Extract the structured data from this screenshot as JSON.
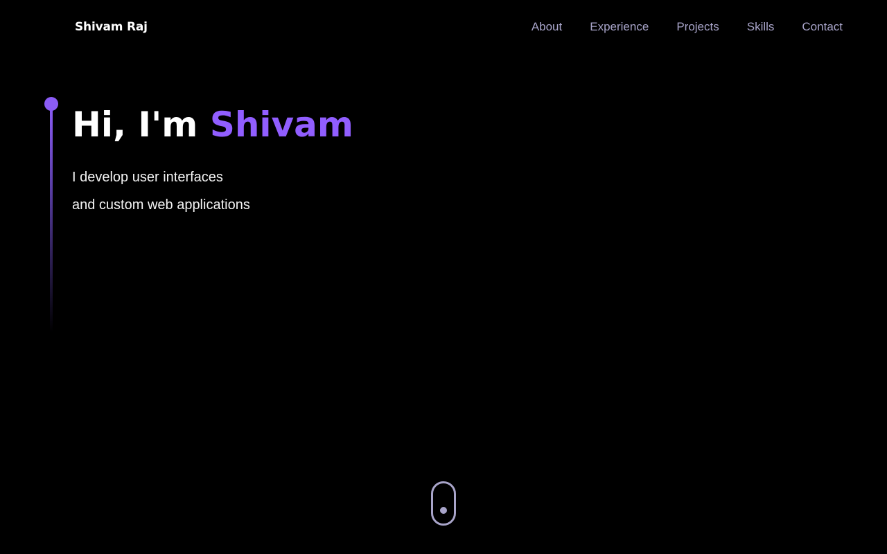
{
  "header": {
    "logo": "Shivam Raj",
    "nav": [
      "About",
      "Experience",
      "Projects",
      "Skills",
      "Contact"
    ]
  },
  "hero": {
    "title_prefix": "Hi, I'm ",
    "title_name": "Shivam",
    "subtitle_line1": "I develop user interfaces",
    "subtitle_line2": "and custom web applications"
  },
  "theme": {
    "background": "#000000",
    "accent": "#915eff",
    "nav_text": "#a8a4c9"
  },
  "icons": {
    "scroll": "mouse-scroll-icon"
  }
}
